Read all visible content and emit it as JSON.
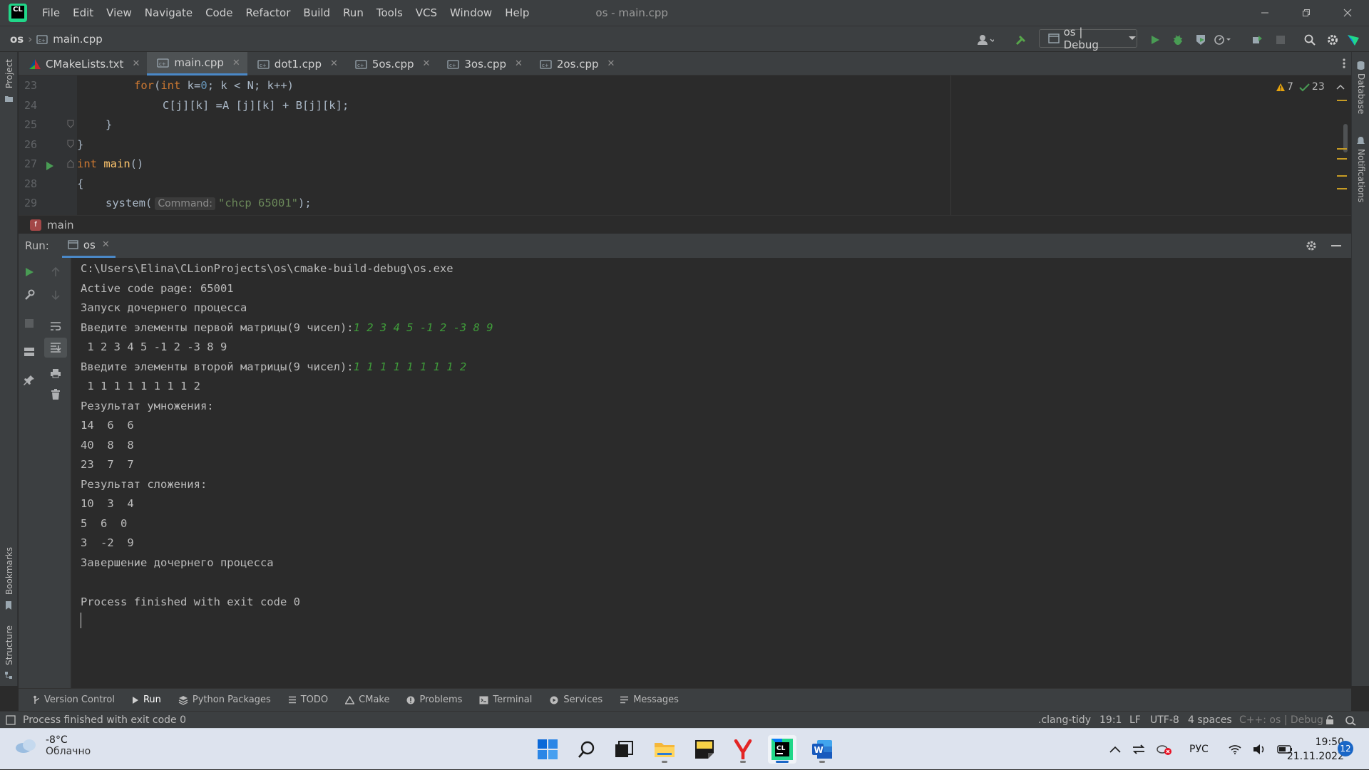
{
  "title_bar": {
    "menu": [
      "File",
      "Edit",
      "View",
      "Navigate",
      "Code",
      "Refactor",
      "Build",
      "Run",
      "Tools",
      "VCS",
      "Window",
      "Help"
    ],
    "window_title": "os - main.cpp"
  },
  "nav_bar": {
    "project": "os",
    "file": "main.cpp",
    "run_config": "os | Debug"
  },
  "left_stripe": {
    "project": "Project",
    "bookmarks": "Bookmarks",
    "structure": "Structure"
  },
  "right_stripe": {
    "database": "Database",
    "notifications": "Notifications"
  },
  "tabs": [
    {
      "label": "CMakeLists.txt",
      "icon": "cmake-icon",
      "active": false
    },
    {
      "label": "main.cpp",
      "icon": "cpp-file-icon",
      "active": true
    },
    {
      "label": "dot1.cpp",
      "icon": "cpp-file-icon",
      "active": false
    },
    {
      "label": "5os.cpp",
      "icon": "cpp-file-icon",
      "active": false
    },
    {
      "label": "3os.cpp",
      "icon": "cpp-file-icon",
      "active": false
    },
    {
      "label": "2os.cpp",
      "icon": "cpp-file-icon",
      "active": false
    }
  ],
  "editor": {
    "line_numbers": [
      "23",
      "24",
      "25",
      "26",
      "27",
      "28",
      "29"
    ],
    "lines": {
      "l23": {
        "kw1": "for",
        "p1": "(",
        "kw2": "int",
        "p2": " k=",
        "n1": "0",
        "p3": "; k < N; k++)"
      },
      "l24": "C[j][k] =A [j][k] + B[j][k];",
      "l25": "}",
      "l26": "}",
      "l27": {
        "kw": "int",
        "fn": "main",
        "rest": "()"
      },
      "l28": "{",
      "l29": {
        "pre": "system(",
        "hint": "Command:",
        "str": "\"chcp 65001\"",
        "post": ");"
      }
    },
    "warnings_count": "7",
    "ok_count": "23",
    "breadcrumb_fn": "main",
    "fn_badge": "f"
  },
  "run_panel": {
    "label": "Run:",
    "tab": "os",
    "console": [
      "C:\\Users\\Elina\\CLionProjects\\os\\cmake-build-debug\\os.exe",
      "Active code page: 65001",
      "Запуск дочернего процесса",
      {
        "prompt": "Введите элементы первой матрицы(9 чисел):",
        "input": "1 2 3 4 5 -1 2 -3 8 9"
      },
      " 1 2 3 4 5 -1 2 -3 8 9",
      {
        "prompt": "Введите элементы второй матрицы(9 чисел):",
        "input": "1 1 1 1 1 1 1 1 2"
      },
      " 1 1 1 1 1 1 1 1 2",
      "Результат умножения:",
      "14  6  6",
      "40  8  8",
      "23  7  7",
      "Результат сложения:",
      "10  3  4",
      "5  6  0",
      "3  -2  9",
      "Завершение дочернего процесса",
      "",
      "Process finished with exit code 0"
    ]
  },
  "tool_windows": [
    {
      "label": "Version Control",
      "icon": "branch-icon"
    },
    {
      "label": "Run",
      "icon": "run-icon",
      "active": true
    },
    {
      "label": "Python Packages",
      "icon": "layers-icon"
    },
    {
      "label": "TODO",
      "icon": "list-icon"
    },
    {
      "label": "CMake",
      "icon": "cmake-icon"
    },
    {
      "label": "Problems",
      "icon": "info-icon"
    },
    {
      "label": "Terminal",
      "icon": "terminal-icon"
    },
    {
      "label": "Services",
      "icon": "services-icon"
    },
    {
      "label": "Messages",
      "icon": "messages-icon"
    }
  ],
  "status_bar": {
    "message": "Process finished with exit code 0",
    "linter": ".clang-tidy",
    "position": "19:1",
    "line_sep": "LF",
    "encoding": "UTF-8",
    "indent": "4 spaces",
    "context": "C++: os | Debug"
  },
  "taskbar": {
    "weather_temp": "-8°C",
    "weather_cond": "Облачно",
    "lang": "РУС",
    "time": "19:50",
    "date": "21.11.2022",
    "notifications": "12"
  },
  "colors": {
    "accent": "#4a88c7",
    "keyword": "#cc7832",
    "function": "#ffc66d",
    "string": "#6a8759",
    "number": "#6897bb",
    "user_input": "#3f9b3a"
  }
}
